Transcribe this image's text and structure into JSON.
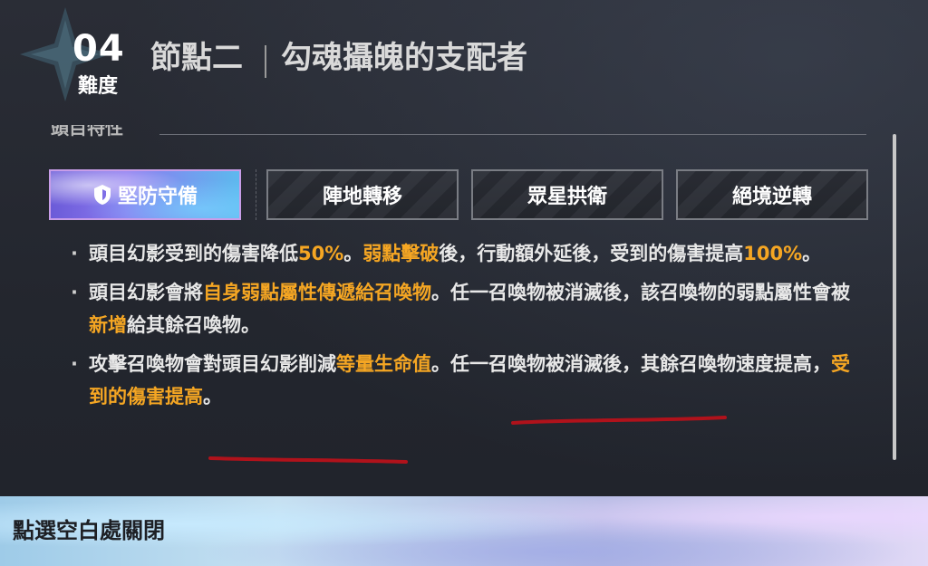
{
  "header": {
    "difficulty_number": "04",
    "difficulty_label": "難度",
    "node_title": "節點二",
    "boss_title": "勾魂攝魄的支配者"
  },
  "section": {
    "label": "頭目特性"
  },
  "tabs": [
    {
      "label": "堅防守備",
      "active": true,
      "icon": "shield-icon"
    },
    {
      "label": "陣地轉移",
      "active": false
    },
    {
      "label": "眾星拱衛",
      "active": false
    },
    {
      "label": "絕境逆轉",
      "active": false
    }
  ],
  "descriptions": [
    {
      "segments": [
        {
          "text": "頭目幻影受到的傷害降低",
          "highlight": false
        },
        {
          "text": "50%",
          "highlight": true
        },
        {
          "text": "。",
          "highlight": false
        },
        {
          "text": "弱點擊破",
          "highlight": true
        },
        {
          "text": "後，行動額外延後，受到的傷害提高",
          "highlight": false
        },
        {
          "text": "100%",
          "highlight": true
        },
        {
          "text": "。",
          "highlight": false
        }
      ]
    },
    {
      "segments": [
        {
          "text": "頭目幻影會將",
          "highlight": false
        },
        {
          "text": "自身弱點屬性傳遞給召喚物",
          "highlight": true
        },
        {
          "text": "。任一召喚物被消滅後，該召喚物的弱點屬性會被",
          "highlight": false
        },
        {
          "text": "新增",
          "highlight": true
        },
        {
          "text": "給其餘召喚物。",
          "highlight": false
        }
      ]
    },
    {
      "segments": [
        {
          "text": "攻擊召喚物會對頭目幻影削減",
          "highlight": false
        },
        {
          "text": "等量生命值",
          "highlight": true
        },
        {
          "text": "。任一召喚物被消滅後，其餘召喚物速度提高，",
          "highlight": false
        },
        {
          "text": "受到的傷害提高",
          "highlight": true
        },
        {
          "text": "。",
          "highlight": false
        }
      ]
    }
  ],
  "footer": {
    "hint": "點選空白處關閉"
  },
  "colors": {
    "highlight": "#f5a623",
    "annotation": "#b0121b",
    "active_tab_border": "#c89de8"
  }
}
